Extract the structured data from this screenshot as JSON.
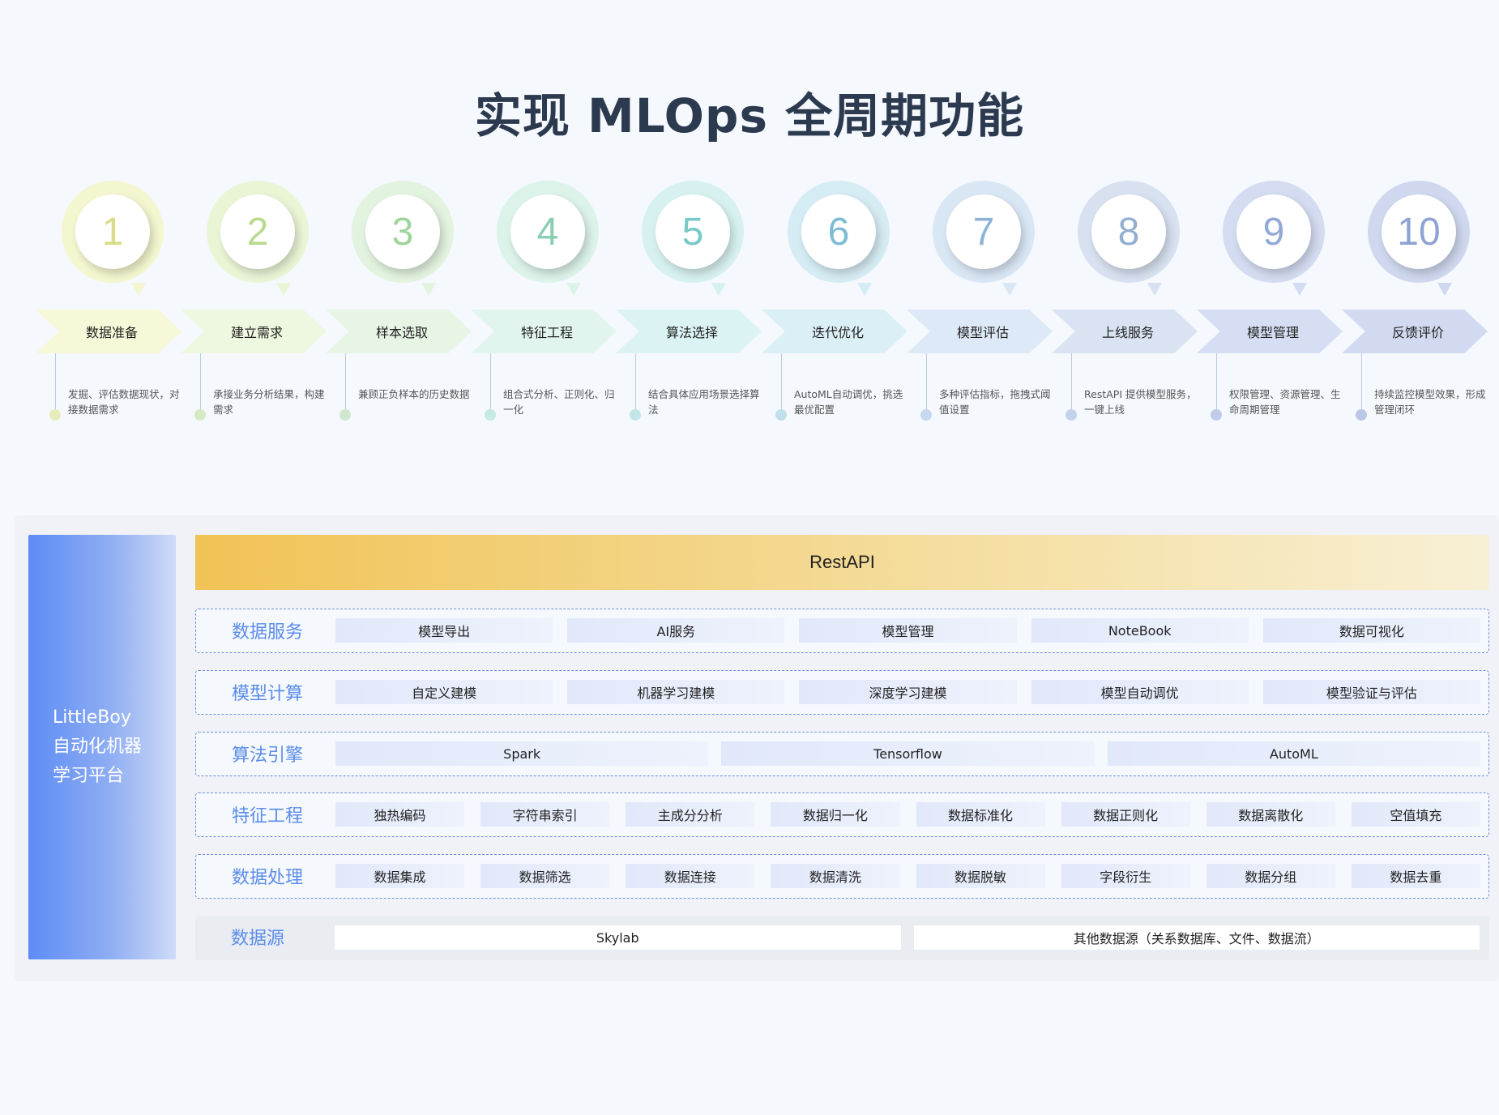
{
  "title": "实现 MLOps 全周期功能",
  "steps": [
    {
      "num": "1",
      "label": "数据准备",
      "desc": "发掘、评估数据现状，对接数据需求",
      "color": "#f4f6cf",
      "text_color": "#d8dd86",
      "arrow": "#f7f8d8",
      "dot": "#e6edb9"
    },
    {
      "num": "2",
      "label": "建立需求",
      "desc": "承接业务分析结果，构建需求",
      "color": "#eaf5d6",
      "text_color": "#b9d98e",
      "arrow": "#eef7df",
      "dot": "#d5eac3"
    },
    {
      "num": "3",
      "label": "样本选取",
      "desc": "兼顾正负样本的历史数据",
      "color": "#e2f3df",
      "text_color": "#9fd49a",
      "arrow": "#e7f5e5",
      "dot": "#cfe8cf"
    },
    {
      "num": "4",
      "label": "特征工程",
      "desc": "组合式分析、正则化、归一化",
      "color": "#dcf3ea",
      "text_color": "#88cfb2",
      "arrow": "#e1f5ee",
      "dot": "#c6e9e0"
    },
    {
      "num": "5",
      "label": "算法选择",
      "desc": "结合具体应用场景选择算法",
      "color": "#d7f1f0",
      "text_color": "#79c9c9",
      "arrow": "#dcf3f3",
      "dot": "#c1e6e8"
    },
    {
      "num": "6",
      "label": "迭代优化",
      "desc": "AutoML自动调优，挑选最优配置",
      "color": "#d6ecf4",
      "text_color": "#7dbcd2",
      "arrow": "#dbeff6",
      "dot": "#c1dfec"
    },
    {
      "num": "7",
      "label": "模型评估",
      "desc": "多种评估指标，拖拽式阈值设置",
      "color": "#d9e7f5",
      "text_color": "#8db3d8",
      "arrow": "#dde9f6",
      "dot": "#c5d8ee"
    },
    {
      "num": "8",
      "label": "上线服务",
      "desc": "RestAPI 提供模型服务，一键上线",
      "color": "#d7e1ef",
      "text_color": "#93aed0",
      "arrow": "#d9e3f1",
      "dot": "#c3d2e8"
    },
    {
      "num": "9",
      "label": "模型管理",
      "desc": "权限管理、资源管理、生命周期管理",
      "color": "#d4dcf1",
      "text_color": "#93a9d6",
      "arrow": "#d6def3",
      "dot": "#c0cbea"
    },
    {
      "num": "10",
      "label": "反馈评价",
      "desc": "持续监控模型效果，形成管理闭环",
      "color": "#cfd8ef",
      "text_color": "#8ea2d3",
      "arrow": "#d2daf1",
      "dot": "#bcc7e8"
    }
  ],
  "platform": {
    "name": "LittleBoy\n自动化机器\n学习平台",
    "name_lines": [
      "LittleBoy",
      "自动化机器",
      "学习平台"
    ],
    "api": "RestAPI",
    "rows": [
      {
        "label": "数据服务",
        "cells": [
          "模型导出",
          "AI服务",
          "模型管理",
          "NoteBook",
          "数据可视化"
        ]
      },
      {
        "label": "模型计算",
        "cells": [
          "自定义建模",
          "机器学习建模",
          "深度学习建模",
          "模型自动调优",
          "模型验证与评估"
        ]
      },
      {
        "label": "算法引擎",
        "cells": [
          "Spark",
          "Tensorflow",
          "AutoML"
        ]
      },
      {
        "label": "特征工程",
        "cells": [
          "独热编码",
          "字符串索引",
          "主成分分析",
          "数据归一化",
          "数据标准化",
          "数据正则化",
          "数据离散化",
          "空值填充"
        ]
      },
      {
        "label": "数据处理",
        "cells": [
          "数据集成",
          "数据筛选",
          "数据连接",
          "数据清洗",
          "数据脱敏",
          "字段衍生",
          "数据分组",
          "数据去重"
        ]
      },
      {
        "label": "数据源",
        "cells": [
          "Skylab",
          "其他数据源（关系数据库、文件、数据流）"
        ]
      }
    ]
  }
}
